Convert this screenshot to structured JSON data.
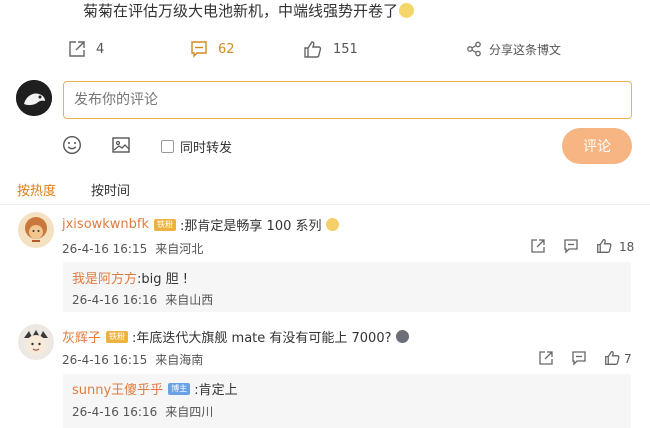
{
  "post": {
    "text": "菊菊在评估万级大电池新机，中端线强势开卷了"
  },
  "actions": {
    "repost_count": "4",
    "comment_count": "62",
    "like_count": "151",
    "share_label": "分享这条博文"
  },
  "composer": {
    "placeholder": "发布你的评论",
    "repost_label": "同时转发",
    "submit_label": "评论"
  },
  "sort": {
    "hot_label": "按热度",
    "time_label": "按时间"
  },
  "comments": [
    {
      "username": "jxisowkwnbfk",
      "badge": "铁粉",
      "text": ":那肯定是畅享 100 系列",
      "time": "26-4-16 16:15",
      "location": "来自河北",
      "likes": "18",
      "reply": {
        "username": "我是阿方方",
        "text": ":big 胆 !",
        "time": "26-4-16 16:16",
        "location": "来自山西"
      }
    },
    {
      "username": "灰辉子",
      "badge": "铁粉",
      "text": ":年底迭代大旗舰 mate 有没有可能上 7000?",
      "time": "26-4-16 16:15",
      "location": "来自海南",
      "likes": "7",
      "reply": {
        "username": "sunny王傻乎乎",
        "badge": "博主",
        "text": ":肯定上",
        "time": "26-4-16 16:16",
        "location": "来自四川"
      }
    }
  ],
  "colors": {
    "accent": "#e07f17",
    "username": "#e07c3e",
    "input_border": "#e8b45a",
    "submit_bg": "#f7b583"
  }
}
